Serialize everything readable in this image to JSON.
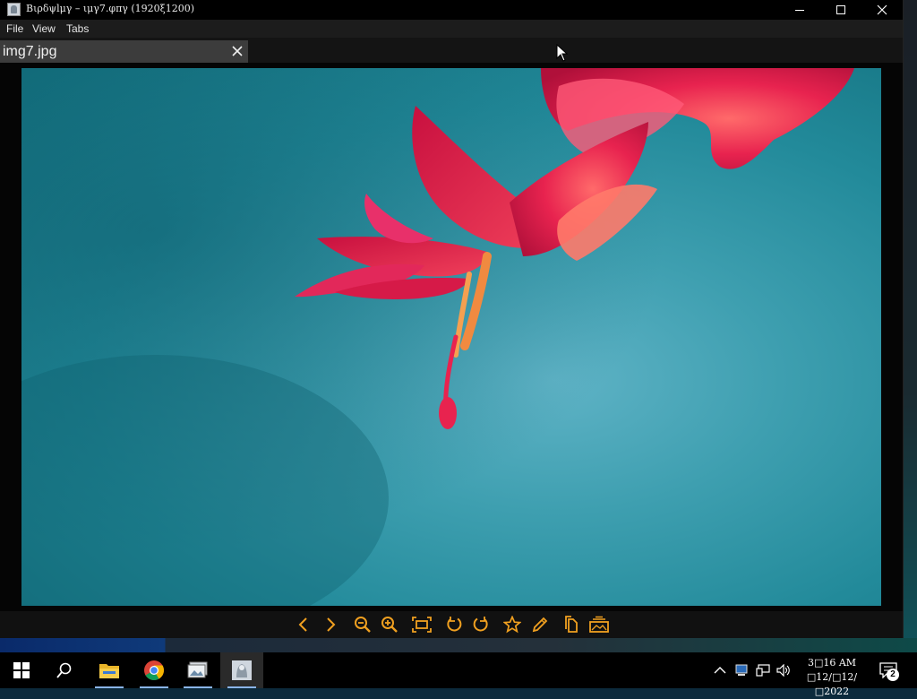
{
  "window": {
    "title": "Βιρδψlμγ – ιμγ7.φπγ (1920ξ1200)"
  },
  "menu": [
    "File",
    "View",
    "Tabs"
  ],
  "tabs": [
    {
      "label": "img7.jpg",
      "close_icon": "close-icon"
    }
  ],
  "image": {
    "subject": "pink-flower-photo"
  },
  "toolbar": {
    "accent": "#f0a020",
    "icons": [
      "chevron-left-icon",
      "chevron-right-icon",
      "zoom-out-icon",
      "zoom-in-icon",
      "fit-window-icon",
      "rotate-left-icon",
      "rotate-right-icon",
      "star-icon",
      "edit-pencil-icon",
      "copy-icon",
      "gallery-icon"
    ]
  },
  "taskbar": {
    "apps": [
      "start-icon",
      "search-icon",
      "file-explorer-icon",
      "chrome-icon",
      "photo-viewer-icon",
      "image-viewer-app-icon"
    ],
    "clock_time": "3□16 AM",
    "clock_date": "□12/□12/□2022",
    "notification_count": "2"
  },
  "colors": {
    "titlebar": "#000000",
    "menubar": "#1c1c1c",
    "tab_active": "#3c3c3c",
    "accent": "#f0a020",
    "flower": "#e8234f",
    "sky": "#3a9fb0"
  }
}
